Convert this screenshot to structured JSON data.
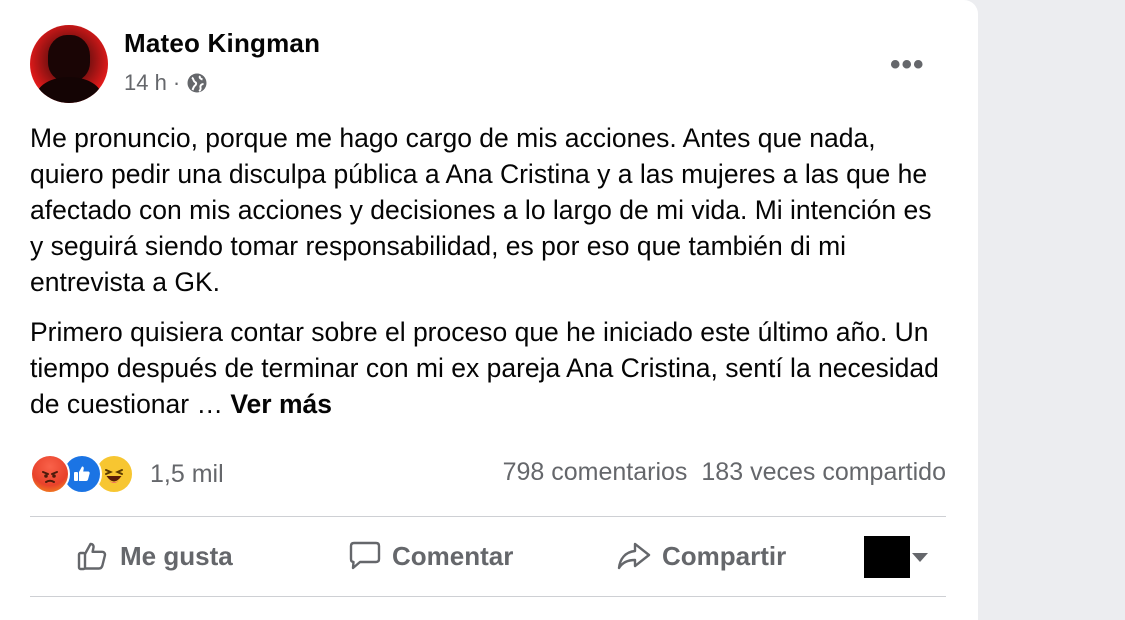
{
  "post": {
    "author": "Mateo Kingman",
    "time": "14 h",
    "separator": "·",
    "privacy_icon": "globe-icon",
    "more_icon": "more-options-icon",
    "more_label": "•••",
    "paragraphs": [
      "Me pronuncio, porque me hago cargo de mis acciones. Antes que nada, quiero pedir una disculpa pública a Ana Cristina y a las mujeres a las que he afectado con mis acciones y decisiones a lo largo de mi vida. Mi intención es y seguirá siendo tomar responsabilidad, es por eso que también di mi entrevista a GK.",
      "Primero quisiera contar sobre el proceso que he iniciado este último año. Un tiempo después de terminar con mi ex pareja Ana Cristina, sentí la necesidad de cuestionar … "
    ],
    "see_more": "Ver más"
  },
  "reactions": {
    "icons": [
      "angry-reaction-icon",
      "like-reaction-icon",
      "haha-reaction-icon"
    ],
    "count": "1,5 mil",
    "comments": "798 comentarios",
    "shares": "183 veces compartido"
  },
  "actions": {
    "like": "Me gusta",
    "comment": "Comentar",
    "share": "Compartir"
  },
  "colors": {
    "text": "#050505",
    "secondary": "#65676b",
    "like_blue": "#1b74e4",
    "angry_red": "#e8422b",
    "haha_yellow": "#f7c631"
  }
}
